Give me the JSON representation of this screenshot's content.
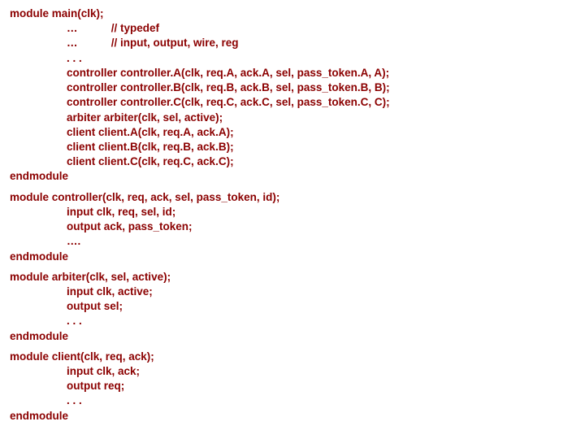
{
  "blocks": [
    {
      "name": "module-main",
      "lines": [
        {
          "indent": 0,
          "text": "module main(clk);"
        },
        {
          "indent": 1,
          "text": "…           // typedef"
        },
        {
          "indent": 1,
          "text": "…           // input, output, wire, reg"
        },
        {
          "indent": 1,
          "text": ". . ."
        },
        {
          "indent": 1,
          "text": "controller controller.A(clk, req.A, ack.A, sel, pass_token.A, A);"
        },
        {
          "indent": 1,
          "text": "controller controller.B(clk, req.B, ack.B, sel, pass_token.B, B);"
        },
        {
          "indent": 1,
          "text": "controller controller.C(clk, req.C, ack.C, sel, pass_token.C, C);"
        },
        {
          "indent": 1,
          "text": "arbiter arbiter(clk, sel, active);"
        },
        {
          "indent": 1,
          "text": "client client.A(clk, req.A, ack.A);"
        },
        {
          "indent": 1,
          "text": "client client.B(clk, req.B, ack.B);"
        },
        {
          "indent": 1,
          "text": "client client.C(clk, req.C, ack.C);"
        },
        {
          "indent": 0,
          "text": "endmodule"
        }
      ]
    },
    {
      "name": "module-controller",
      "lines": [
        {
          "indent": 0,
          "text": "module controller(clk, req, ack, sel, pass_token, id);"
        },
        {
          "indent": 1,
          "text": "input clk, req, sel, id;"
        },
        {
          "indent": 1,
          "text": "output ack, pass_token;"
        },
        {
          "indent": 1,
          "text": "…."
        },
        {
          "indent": 0,
          "text": "endmodule"
        }
      ]
    },
    {
      "name": "module-arbiter",
      "lines": [
        {
          "indent": 0,
          "text": "module arbiter(clk, sel, active);"
        },
        {
          "indent": 1,
          "text": "input clk, active;"
        },
        {
          "indent": 1,
          "text": "output sel;"
        },
        {
          "indent": 1,
          "text": ". . ."
        },
        {
          "indent": 0,
          "text": "endmodule"
        }
      ]
    },
    {
      "name": "module-client",
      "lines": [
        {
          "indent": 0,
          "text": "module client(clk, req, ack);"
        },
        {
          "indent": 1,
          "text": "input clk, ack;"
        },
        {
          "indent": 1,
          "text": "output req;"
        },
        {
          "indent": 1,
          "text": ". . ."
        },
        {
          "indent": 0,
          "text": "endmodule"
        }
      ]
    }
  ]
}
